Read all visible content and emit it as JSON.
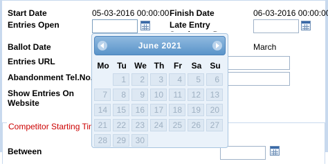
{
  "form": {
    "start_date_label": "Start Date",
    "start_date_value": "05-03-2016 00:00:00",
    "finish_date_label": "Finish Date",
    "finish_date_value": "06-03-2016 00:00:00",
    "entries_open_label": "Entries Open",
    "entries_open_value": "",
    "late_entry_label": "Late Entry Surcharge Date",
    "late_entry_value": "",
    "ballot_date_label": "Ballot Date",
    "ballot_date_partial": "March",
    "entries_url_label": "Entries URL",
    "entries_url_value": "",
    "abandonment_label": "Abandonment Tel.No.",
    "abandonment_value": "",
    "show_entries_label_1": "Show Entries On",
    "show_entries_label_2": "Website",
    "competitor_legend": "Competitor Starting Time",
    "between_label": "Between"
  },
  "datepicker": {
    "title": "June  2021",
    "days_of_week": [
      "Mo",
      "Tu",
      "We",
      "Th",
      "Fr",
      "Sa",
      "Su"
    ],
    "days": [
      "1",
      "2",
      "3",
      "4",
      "5",
      "6",
      "7",
      "8",
      "9",
      "10",
      "11",
      "12",
      "13",
      "14",
      "15",
      "16",
      "17",
      "18",
      "19",
      "20",
      "21",
      "22",
      "23",
      "24",
      "25",
      "26",
      "27",
      "28",
      "29",
      "30"
    ],
    "leading_blank_cells": 1
  },
  "icons": {
    "calendar": "calendar-icon",
    "prev": "chevron-left-icon",
    "next": "chevron-right-icon"
  },
  "colors": {
    "header_start": "#8fb9df",
    "header_end": "#5a94c9",
    "legend": "#cc0000",
    "frame": "#c8d9ee"
  }
}
